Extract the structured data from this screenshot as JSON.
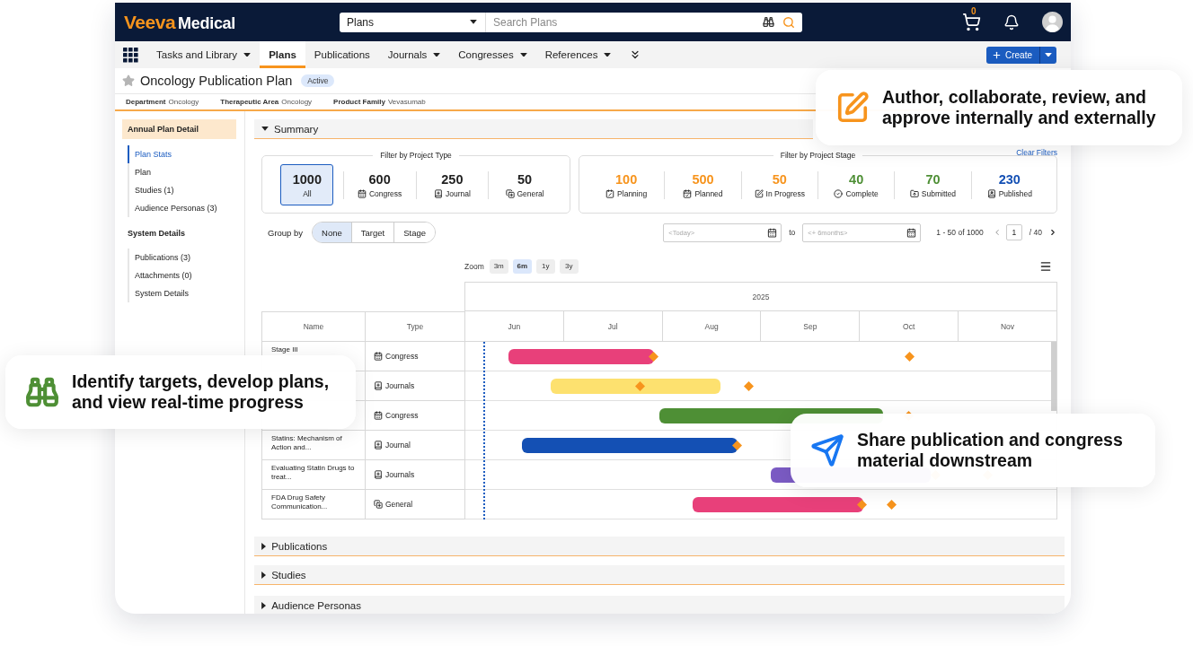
{
  "top_bar": {
    "logo": {
      "brand": "Veeva",
      "product": "Medical"
    },
    "search": {
      "scope": "Plans",
      "placeholder": "Search Plans"
    },
    "cart_count": "0"
  },
  "nav_tabs": [
    {
      "label": "Tasks and Library",
      "dropdown": true,
      "selected": false
    },
    {
      "label": "Plans",
      "dropdown": false,
      "selected": true
    },
    {
      "label": "Publications",
      "dropdown": false,
      "selected": false
    },
    {
      "label": "Journals",
      "dropdown": true,
      "selected": false
    },
    {
      "label": "Congresses",
      "dropdown": true,
      "selected": false
    },
    {
      "label": "References",
      "dropdown": true,
      "selected": false
    }
  ],
  "create_button": {
    "label": "Create"
  },
  "plan": {
    "title": "Oncology Publication Plan",
    "status": "Active",
    "fields": [
      {
        "label": "Department",
        "value": "Oncology"
      },
      {
        "label": "Therapeutic Area",
        "value": "Oncology"
      },
      {
        "label": "Product Family",
        "value": "Vevasumab"
      }
    ]
  },
  "sidebar": {
    "sections": [
      {
        "title": "Annual Plan Detail",
        "highlighted": true,
        "items": [
          {
            "label": "Plan Stats",
            "selected": true
          },
          {
            "label": "Plan",
            "selected": false
          },
          {
            "label": "Studies (1)",
            "selected": false
          },
          {
            "label": "Audience Personas (3)",
            "selected": false
          }
        ]
      },
      {
        "title": "System Details",
        "highlighted": false,
        "items": [
          {
            "label": "Publications (3)",
            "selected": false
          },
          {
            "label": "Attachments (0)",
            "selected": false
          },
          {
            "label": "System Details",
            "selected": false
          }
        ]
      }
    ]
  },
  "summary": {
    "title": "Summary",
    "expanded": true,
    "type_filter": {
      "legend": "Filter by Project Type",
      "items": [
        {
          "count": "1000",
          "label": "All",
          "kind": "all",
          "selected": true
        },
        {
          "count": "600",
          "label": "Congress",
          "kind": "congress",
          "selected": false
        },
        {
          "count": "250",
          "label": "Journal",
          "kind": "journal",
          "selected": false
        },
        {
          "count": "50",
          "label": "General",
          "kind": "general",
          "selected": false
        }
      ]
    },
    "stage_filter": {
      "legend": "Filter by Project Stage",
      "clear_link": "Clear Filters",
      "items": [
        {
          "count": "100",
          "label": "Planning",
          "kind": "planning",
          "color": "#f7941d",
          "selected": false
        },
        {
          "count": "500",
          "label": "Planned",
          "kind": "planned",
          "color": "#f7941d",
          "selected": false
        },
        {
          "count": "50",
          "label": "In Progress",
          "kind": "progress",
          "color": "#f7941d",
          "selected": false
        },
        {
          "count": "40",
          "label": "Complete",
          "kind": "complete",
          "color": "#4e8f35",
          "selected": false
        },
        {
          "count": "70",
          "label": "Submitted",
          "kind": "submitted",
          "color": "#4e8f35",
          "selected": false
        },
        {
          "count": "230",
          "label": "Published",
          "kind": "published",
          "color": "#1450b4",
          "selected": false
        }
      ]
    },
    "group_by": {
      "label": "Group by",
      "options": [
        {
          "label": "None",
          "selected": true
        },
        {
          "label": "Target",
          "selected": false
        },
        {
          "label": "Stage",
          "selected": false
        }
      ]
    },
    "date_range": {
      "from": {
        "placeholder": "<Today>"
      },
      "separator": "to",
      "to": {
        "placeholder": "<+ 6months>"
      }
    },
    "pagination": {
      "range": "1 - 50 of 1000",
      "page": "1",
      "total": "/ 40"
    },
    "zoom": {
      "label": "Zoom",
      "options": [
        {
          "label": "3m",
          "selected": false
        },
        {
          "label": "6m",
          "selected": true
        },
        {
          "label": "1y",
          "selected": false
        },
        {
          "label": "3y",
          "selected": false
        }
      ]
    },
    "gantt": {
      "columns": [
        "Name",
        "Type"
      ],
      "year": "2025",
      "months": [
        "Jun",
        "Jul",
        "Aug",
        "Sep",
        "Oct",
        "Nov"
      ],
      "rows": [
        {
          "name": "Stage III",
          "type": "Congress",
          "kind": "congress",
          "color": "#e8407a"
        },
        {
          "type": "Journals",
          "kind": "journal",
          "color": "#fde16f"
        },
        {
          "type": "Congress",
          "kind": "congress",
          "color": "#4e8f35"
        },
        {
          "name": "Statins: Mechanism of Action and...",
          "type": "Journal",
          "kind": "journal",
          "color": "#1450b4"
        },
        {
          "name": "Evaluating Statin Drugs to treat...",
          "type": "Journals",
          "kind": "journal",
          "color": "#7b5bc4"
        },
        {
          "name": "FDA Drug Safety Communication...",
          "type": "General",
          "kind": "general",
          "color": "#e8407a"
        }
      ]
    }
  },
  "sections": [
    {
      "title": "Publications",
      "expanded": false
    },
    {
      "title": "Studies",
      "expanded": false
    },
    {
      "title": "Audience Personas",
      "expanded": false
    }
  ],
  "callouts": [
    {
      "kind": "edit",
      "text": "Author, collaborate, review, and approve internally and externally"
    },
    {
      "kind": "binoculars",
      "text": "Identify targets, develop plans, and view real-time progress"
    },
    {
      "kind": "send",
      "text": "Share publication and congress material downstream"
    }
  ]
}
